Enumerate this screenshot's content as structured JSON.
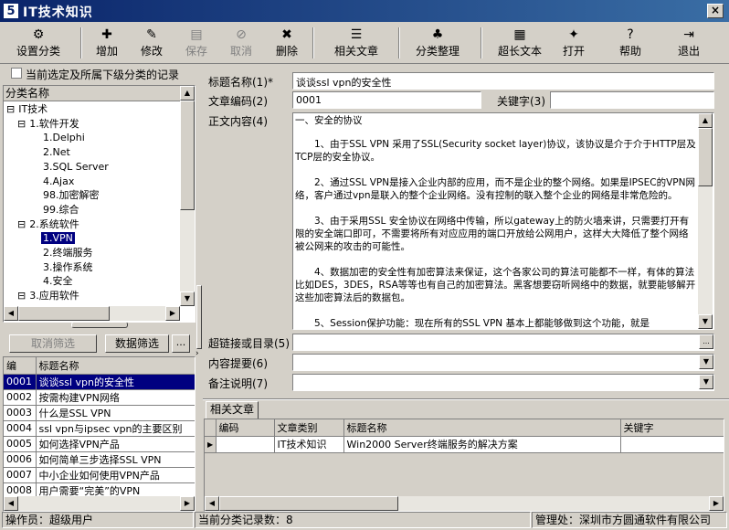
{
  "window": {
    "title": "IT技术知识",
    "logo": "5",
    "close": "×"
  },
  "toolbar": [
    {
      "label": "设置分类",
      "icon": "settings-tree-icon",
      "glyph": "⚙",
      "enabled": true
    },
    {
      "label": "增加",
      "icon": "add-icon",
      "glyph": "✚",
      "enabled": true
    },
    {
      "label": "修改",
      "icon": "edit-icon",
      "glyph": "✎",
      "enabled": true
    },
    {
      "label": "保存",
      "icon": "save-icon",
      "glyph": "▤",
      "enabled": false
    },
    {
      "label": "取消",
      "icon": "cancel-icon",
      "glyph": "⊘",
      "enabled": false
    },
    {
      "label": "删除",
      "icon": "delete-icon",
      "glyph": "✖",
      "enabled": true
    },
    {
      "label": "相关文章",
      "icon": "related-list-icon",
      "glyph": "☰",
      "enabled": true
    },
    {
      "label": "分类整理",
      "icon": "organize-icon",
      "glyph": "♣",
      "enabled": true
    },
    {
      "label": "超长文本",
      "icon": "long-text-icon",
      "glyph": "▦",
      "enabled": true
    },
    {
      "label": "打开",
      "icon": "open-icon",
      "glyph": "✦",
      "enabled": true
    },
    {
      "label": "帮助",
      "icon": "help-icon",
      "glyph": "?",
      "enabled": true
    },
    {
      "label": "退出",
      "icon": "exit-icon",
      "glyph": "⇥",
      "enabled": true
    }
  ],
  "left": {
    "checkbox_label": "当前选定及所属下级分类的记录",
    "tree_header": "分类名称",
    "tree": [
      {
        "text": "IT技术",
        "prefix": "⊟"
      },
      {
        "text": "1.软件开发",
        "prefix": "⊟"
      },
      {
        "text": "1.Delphi",
        "prefix": ""
      },
      {
        "text": "2.Net",
        "prefix": ""
      },
      {
        "text": "3.SQL Server",
        "prefix": ""
      },
      {
        "text": "4.Ajax",
        "prefix": ""
      },
      {
        "text": "98.加密解密",
        "prefix": ""
      },
      {
        "text": "99.综合",
        "prefix": ""
      },
      {
        "text": "2.系统软件",
        "prefix": "⊟"
      },
      {
        "text": "1.VPN",
        "prefix": "",
        "selected": true
      },
      {
        "text": "2.终端服务",
        "prefix": ""
      },
      {
        "text": "3.操作系统",
        "prefix": ""
      },
      {
        "text": "4.安全",
        "prefix": ""
      },
      {
        "text": "3.应用软件",
        "prefix": "⊟"
      }
    ],
    "cancel_filter": "取消筛选",
    "data_filter": "数据筛选",
    "ellipsis": "...",
    "list_headers": {
      "code": "编",
      "title": "标题名称"
    },
    "list": [
      {
        "code": "0001",
        "title": "谈谈ssl vpn的安全性",
        "selected": true
      },
      {
        "code": "0002",
        "title": "按需构建VPN网络"
      },
      {
        "code": "0003",
        "title": "什么是SSL VPN"
      },
      {
        "code": "0004",
        "title": "ssl vpn与ipsec vpn的主要区别"
      },
      {
        "code": "0005",
        "title": "如何选择VPN产品"
      },
      {
        "code": "0006",
        "title": "如何简单三步选择SSL VPN"
      },
      {
        "code": "0007",
        "title": "中小企业如何使用VPN产品"
      },
      {
        "code": "0008",
        "title": "用户需要“完美”的VPN"
      }
    ]
  },
  "form": {
    "title_label": "标题名称(1)*",
    "title_value": "谈谈ssl vpn的安全性",
    "code_label": "文章编码(2)",
    "code_value": "0001",
    "keyword_label": "关键字(3)",
    "keyword_value": "",
    "content_label": "正文内容(4)",
    "content_paragraphs": [
      "一、安全的协议",
      "　　1、由于SSL VPN 采用了SSL(Security socket layer)协议，该协议是介于介于HTTP层及TCP层的安全协议。",
      "　　2、通过SSL VPN是接入企业内部的应用，而不是企业的整个网络。如果是IPSEC的VPN网络，客户通过vpn是联入的整个企业网络。没有控制的联入整个企业的网络是非常危险的。",
      "　　3、由于采用SSL 安全协议在网络中传输，所以gateway上的防火墙来讲，只需要打开有限的安全端口即可，不需要将所有对应应用的端口开放给公网用户，这样大大降低了整个网络被公网来的攻击的可能性。",
      "",
      "　　4、数据加密的安全性有加密算法来保证，这个各家公司的算法可能都不一样，有体的算法比如DES，3DES，RSA等等也有自己的加密算法。黑客想要窃听网络中的数据，就要能够解开这些加密算法后的数据包。",
      "　　5、Session保护功能：现在所有的SSL VPN 基本上都能够做到这个功能，就是"
    ],
    "hyperlink_label": "超链接或目录(5)",
    "hyperlink_value": "",
    "summary_label": "内容提要(6)",
    "summary_value": "",
    "remark_label": "备注说明(7)",
    "remark_value": ""
  },
  "related": {
    "tab_label": "相关文章",
    "headers": [
      "编码",
      "文章类别",
      "标题名称",
      "关键字"
    ],
    "rows": [
      {
        "code": "",
        "category": "IT技术知识",
        "title": "Win2000 Server终端服务的解决方案",
        "keyword": ""
      }
    ]
  },
  "status": {
    "operator": "操作员：超级用户",
    "records": "当前分类记录数：8",
    "manager": "管理处：深圳市方圆通软件有限公司"
  }
}
